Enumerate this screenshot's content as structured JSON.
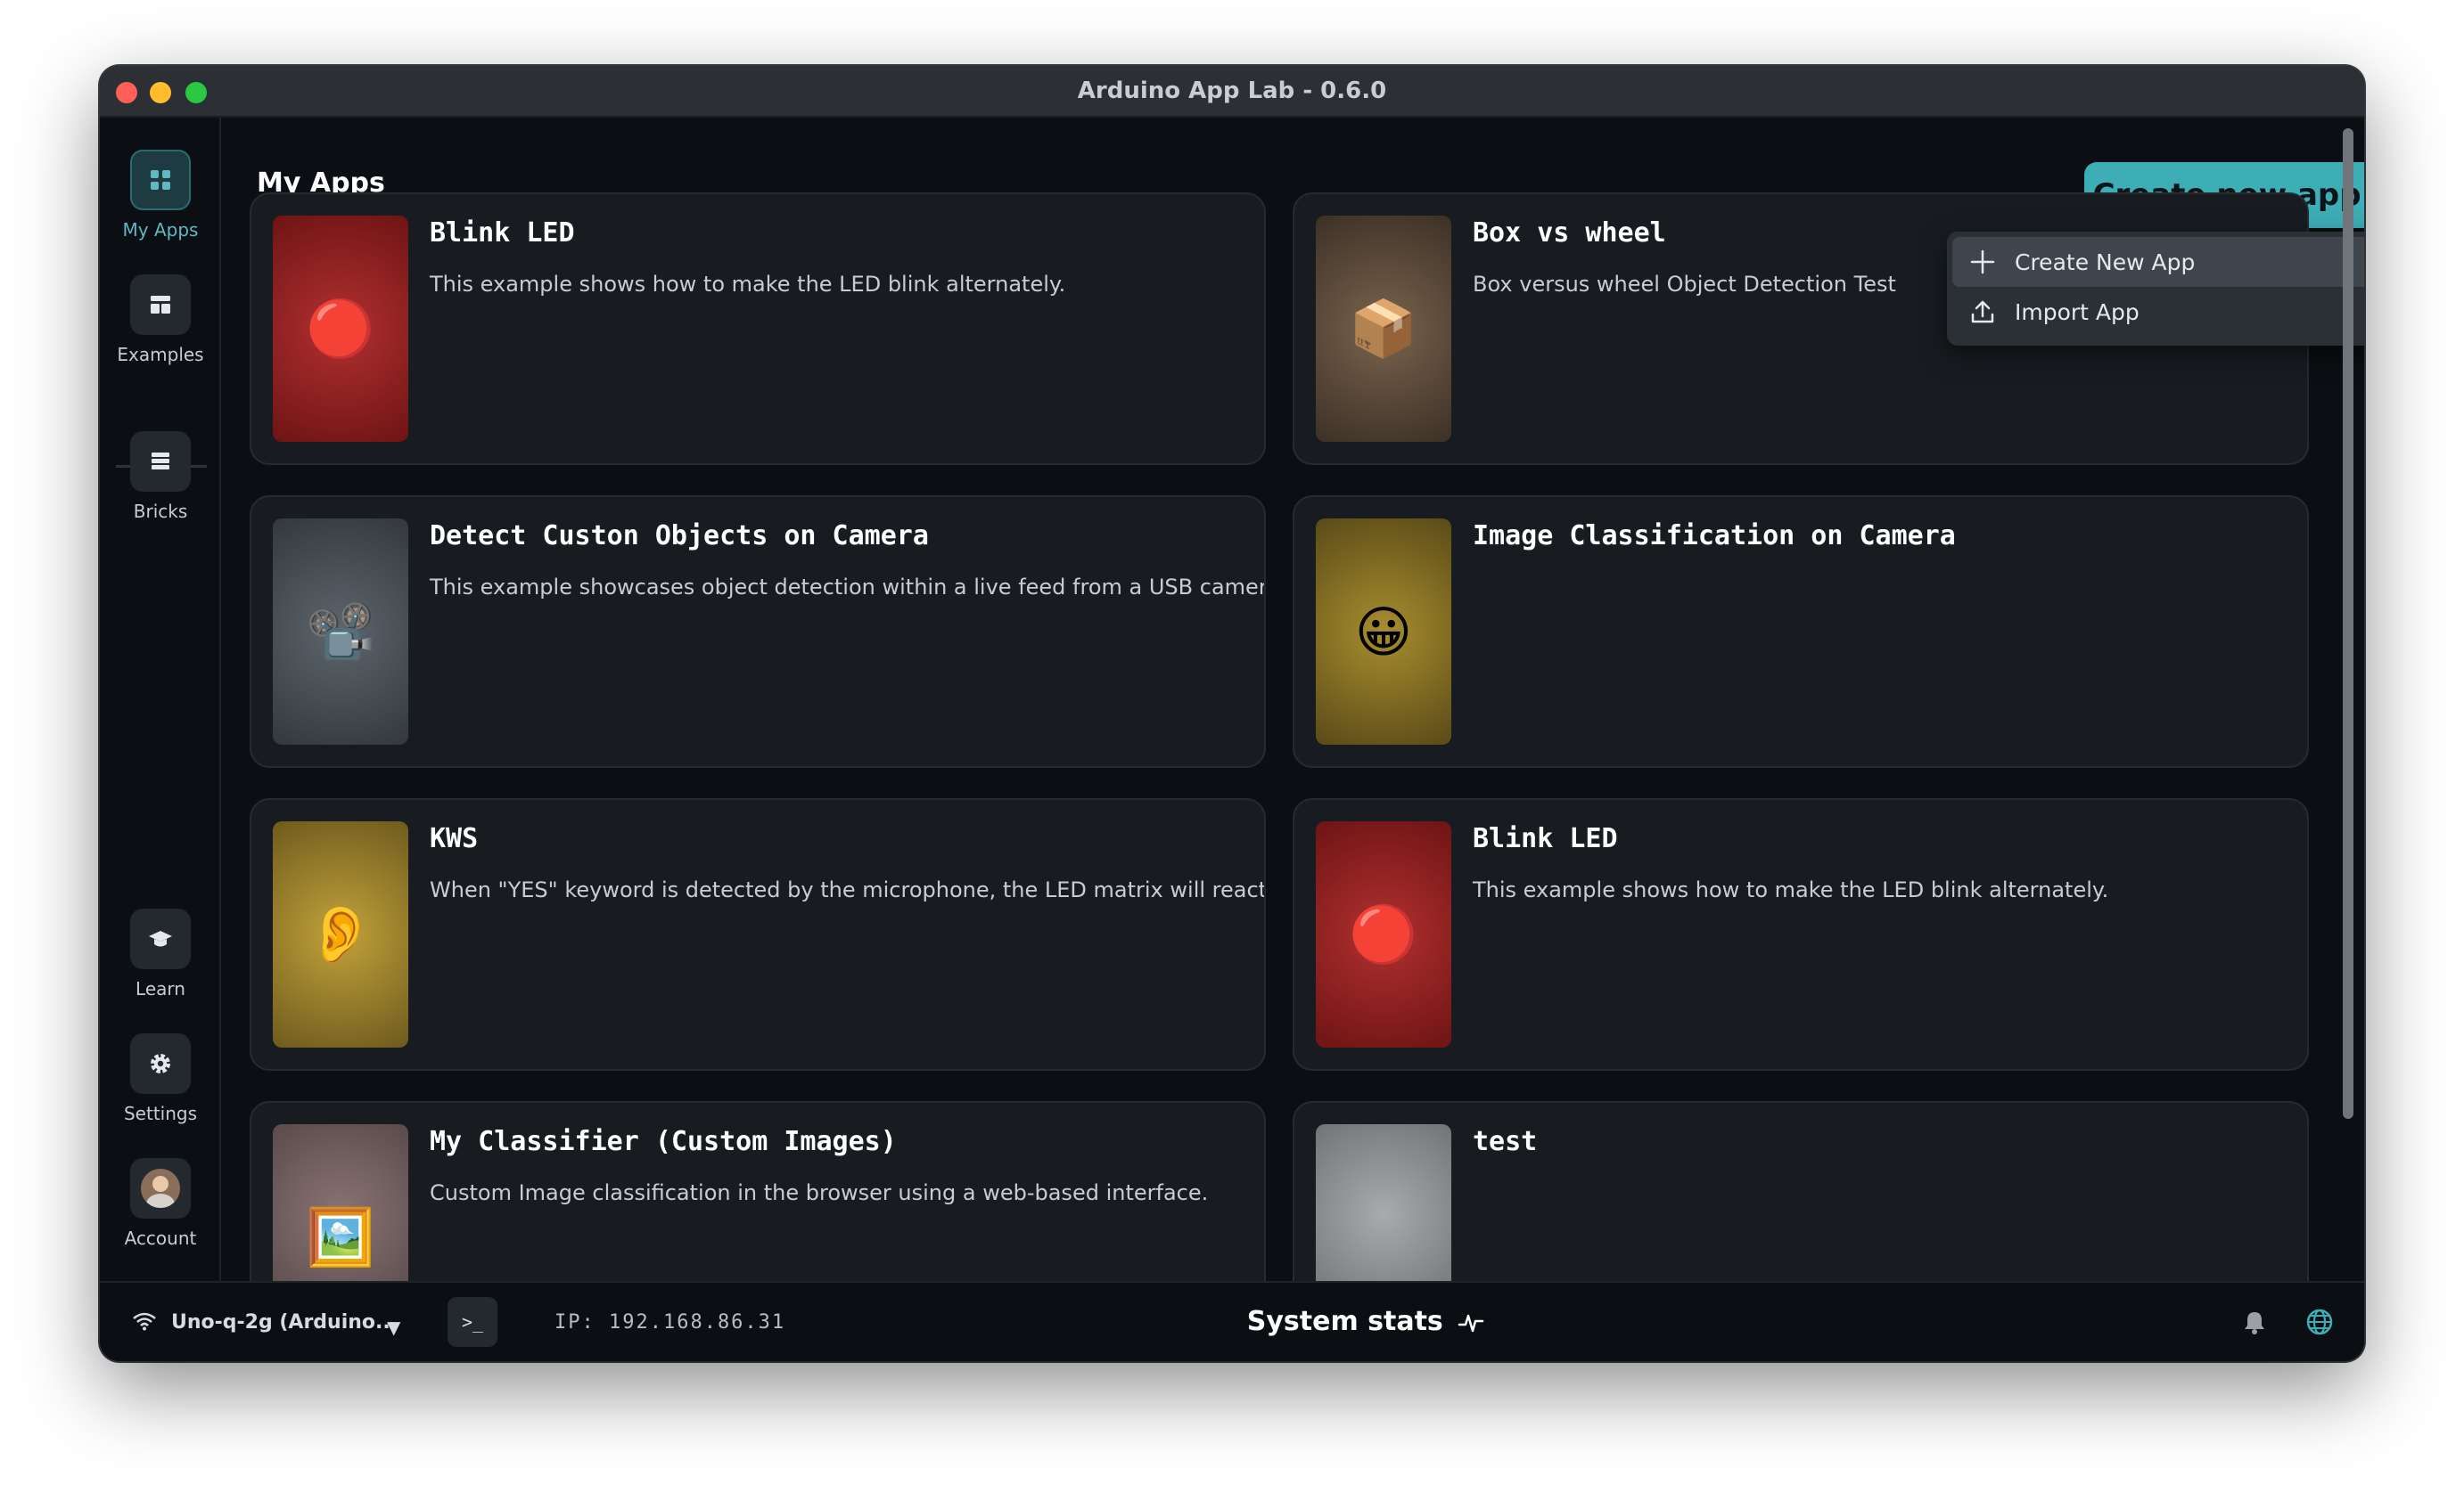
{
  "window": {
    "title": "Arduino App Lab - 0.6.0"
  },
  "sidebar": {
    "items": [
      {
        "label": "My Apps",
        "icon": "grid-icon"
      },
      {
        "label": "Examples",
        "icon": "layout-icon"
      },
      {
        "label": "Bricks",
        "icon": "bricks-icon"
      },
      {
        "label": "Learn",
        "icon": "graduation-cap-icon"
      },
      {
        "label": "Settings",
        "icon": "gear-icon"
      },
      {
        "label": "Account",
        "icon": "avatar"
      }
    ]
  },
  "header": {
    "title": "My Apps",
    "create_button": "Create new app",
    "create_button_icon": "+"
  },
  "dropdown": {
    "items": [
      {
        "label": "Create New App",
        "icon": "plus-icon"
      },
      {
        "label": "Import App",
        "icon": "upload-icon"
      }
    ]
  },
  "apps": [
    {
      "title": "Blink LED",
      "description": "This example shows how to make the LED blink alternately.",
      "emoji": "🔴",
      "color": "#8f2020"
    },
    {
      "title": "Box vs wheel",
      "description": "Box versus wheel Object Detection Test",
      "emoji": "📦",
      "color": "#5e4a38"
    },
    {
      "title": "Detect Custon Objects on Camera",
      "description": "This example showcases object detection within a live feed from a USB camera.",
      "emoji": "📽️",
      "color": "#4a5056"
    },
    {
      "title": "Image Classification on Camera",
      "description": "",
      "emoji": "😀",
      "color": "#8a7424"
    },
    {
      "title": "KWS",
      "description": "When \"YES\" keyword is detected by the microphone, the LED matrix will react",
      "emoji": "👂",
      "color": "#9e852a"
    },
    {
      "title": "Blink LED",
      "description": "This example shows how to make the LED blink alternately.",
      "emoji": "🔴",
      "color": "#8f2020"
    },
    {
      "title": "My Classifier (Custom Images)",
      "description": "Custom Image classification in the browser using a web-based interface.",
      "emoji": "🖼️",
      "color": "#6a5858"
    },
    {
      "title": "test",
      "description": "",
      "emoji": "",
      "color": "#8a8d90"
    }
  ],
  "statusbar": {
    "device": "Uno-q-2g (Arduino...",
    "terminal": ">_",
    "ip": "IP: 192.168.86.31",
    "system_stats": "System stats"
  },
  "colors": {
    "accent": "#3dadb6",
    "background": "#0b0f13",
    "card": "#181c20"
  }
}
